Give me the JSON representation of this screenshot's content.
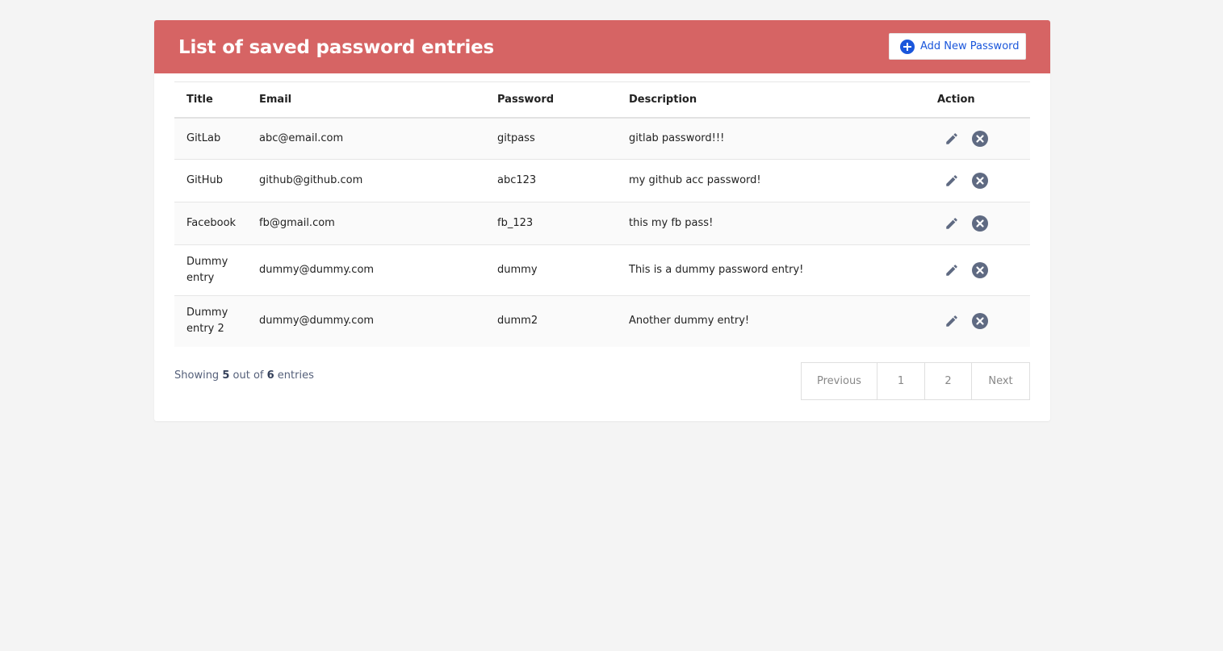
{
  "header": {
    "title": "List of saved password entries",
    "add_button_label": "Add New Password"
  },
  "table": {
    "columns": [
      "Title",
      "Email",
      "Password",
      "Description",
      "Action"
    ],
    "rows": [
      {
        "title": "GitLab",
        "email": "abc@email.com",
        "password": "gitpass",
        "description": "gitlab password!!!"
      },
      {
        "title": "GitHub",
        "email": "github@github.com",
        "password": "abc123",
        "description": "my github acc password!"
      },
      {
        "title": "Facebook",
        "email": "fb@gmail.com",
        "password": "fb_123",
        "description": "this my fb pass!"
      },
      {
        "title": "Dummy entry",
        "email": "dummy@dummy.com",
        "password": "dummy",
        "description": "This is a dummy password entry!"
      },
      {
        "title": "Dummy entry 2",
        "email": "dummy@dummy.com",
        "password": "dumm2",
        "description": "Another dummy entry!"
      }
    ]
  },
  "footer": {
    "showing_prefix": "Showing",
    "shown_count": "5",
    "showing_middle": "out of",
    "total_count": "6",
    "showing_suffix": "entries"
  },
  "pagination": {
    "previous_label": "Previous",
    "pages": [
      "1",
      "2"
    ],
    "next_label": "Next"
  },
  "icons": {
    "add": "plus-circle-icon",
    "edit": "pencil-icon",
    "delete": "close-circle-icon"
  },
  "colors": {
    "header_bg": "#d66464",
    "accent_blue": "#1a56db",
    "icon_gray": "#5f6a82"
  }
}
